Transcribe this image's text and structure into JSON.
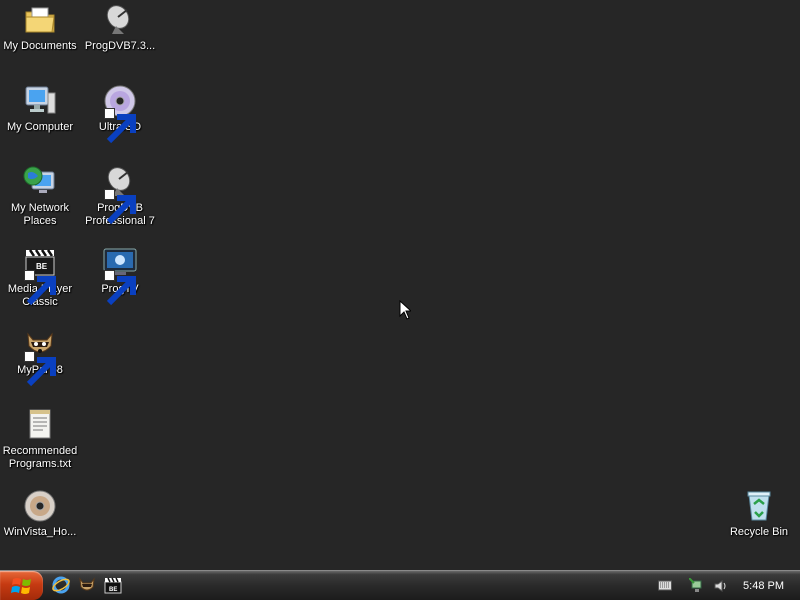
{
  "desktop": {
    "icons": [
      {
        "label": "My Documents",
        "icon": "folder-documents-icon"
      },
      {
        "label": "ProgDVB7.3...",
        "icon": "satellite-dish-icon"
      },
      {
        "label": "My Computer",
        "icon": "computer-icon"
      },
      {
        "label": "UltraISO",
        "icon": "disc-icon"
      },
      {
        "label": "My Network\nPlaces",
        "icon": "network-globe-icon"
      },
      {
        "label": "ProgDVB\nProfessional 7",
        "icon": "satellite-dish-icon"
      },
      {
        "label": "Media Player\nClassic",
        "icon": "clapperboard-icon"
      },
      {
        "label": "ProgTV",
        "icon": "tv-monitor-icon"
      },
      {
        "label": "MyPal 68",
        "icon": "raccoon-icon"
      },
      {
        "label": "Recommended\nPrograms.txt",
        "icon": "text-file-icon"
      },
      {
        "label": "WinVista_Ho...",
        "icon": "disc-icon"
      },
      {
        "label": "Recycle Bin",
        "icon": "recycle-bin-icon"
      }
    ]
  },
  "taskbar": {
    "start_icon": "windows-logo-icon",
    "quick_launch": [
      "internet-explorer-icon",
      "mypal-icon",
      "media-player-classic-icon"
    ],
    "tray": [
      "keyboard-icon",
      "network-icon",
      "volume-icon"
    ],
    "clock": "5:48 PM"
  },
  "colors": {
    "desktop_background": "#262626",
    "start_button": "#c63b12",
    "taskbar": "#2a2a2a"
  }
}
